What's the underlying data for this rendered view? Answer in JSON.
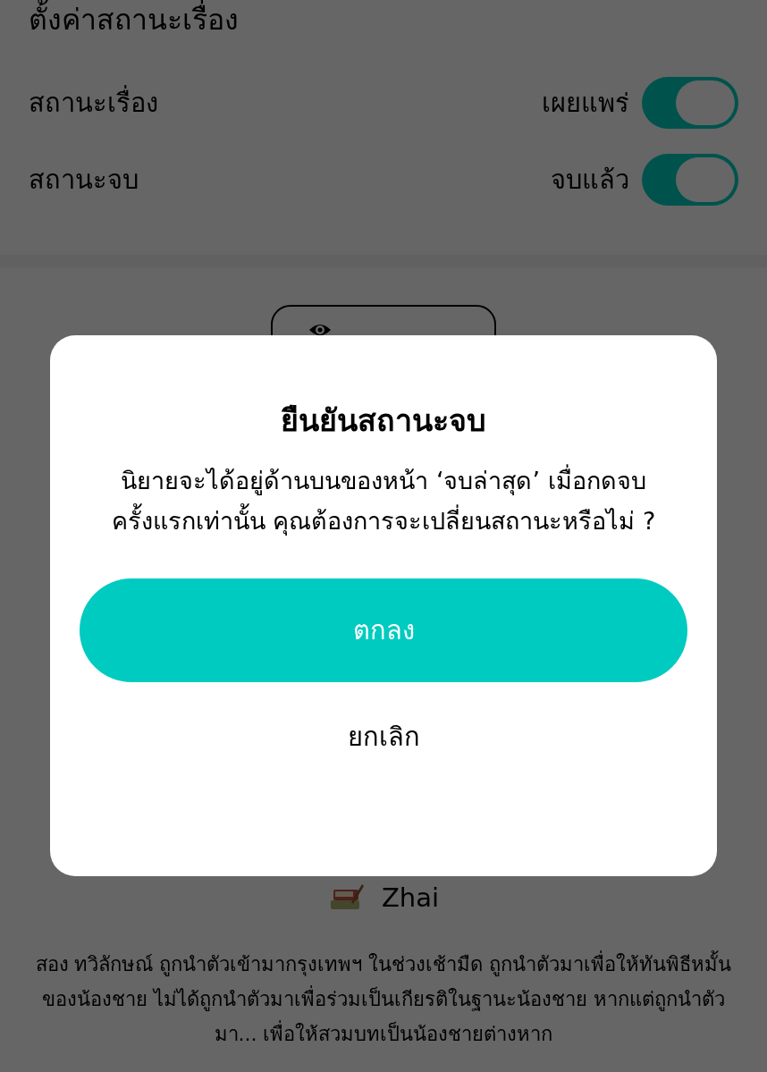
{
  "header": {
    "title": "ตั้งค่าสถานะเรื่อง"
  },
  "settings": [
    {
      "label": "สถานะเรื่อง",
      "value": "เผยแพร่",
      "on": true
    },
    {
      "label": "สถานะจบ",
      "value": "จบแล้ว",
      "on": true
    }
  ],
  "author": {
    "name": "Zhai"
  },
  "synopsis": "สอง ทวิลักษณ์ ถูกนำตัวเข้ามากรุงเทพฯ ในช่วงเช้ามืด ถูกนำตัวมาเพื่อให้ทันพิธีหมั้นของน้องชาย ไม่ได้ถูกนำตัวมาเพื่อร่วมเป็นเกียรติในฐานะน้องชาย หากแต่ถูกนำตัวมา... เพื่อให้สวมบทเป็นน้องชายต่างหาก",
  "dialog": {
    "title": "ยืนยันสถานะจบ",
    "message": "นิยายจะได้อยู่ด้านบนของหน้า ‘จบล่าสุด’ เมื่อกดจบครั้งแรกเท่านั้น คุณต้องการจะเปลี่ยนสถานะหรือไม่ ?",
    "confirm": "ตกลง",
    "cancel": "ยกเลิก"
  }
}
